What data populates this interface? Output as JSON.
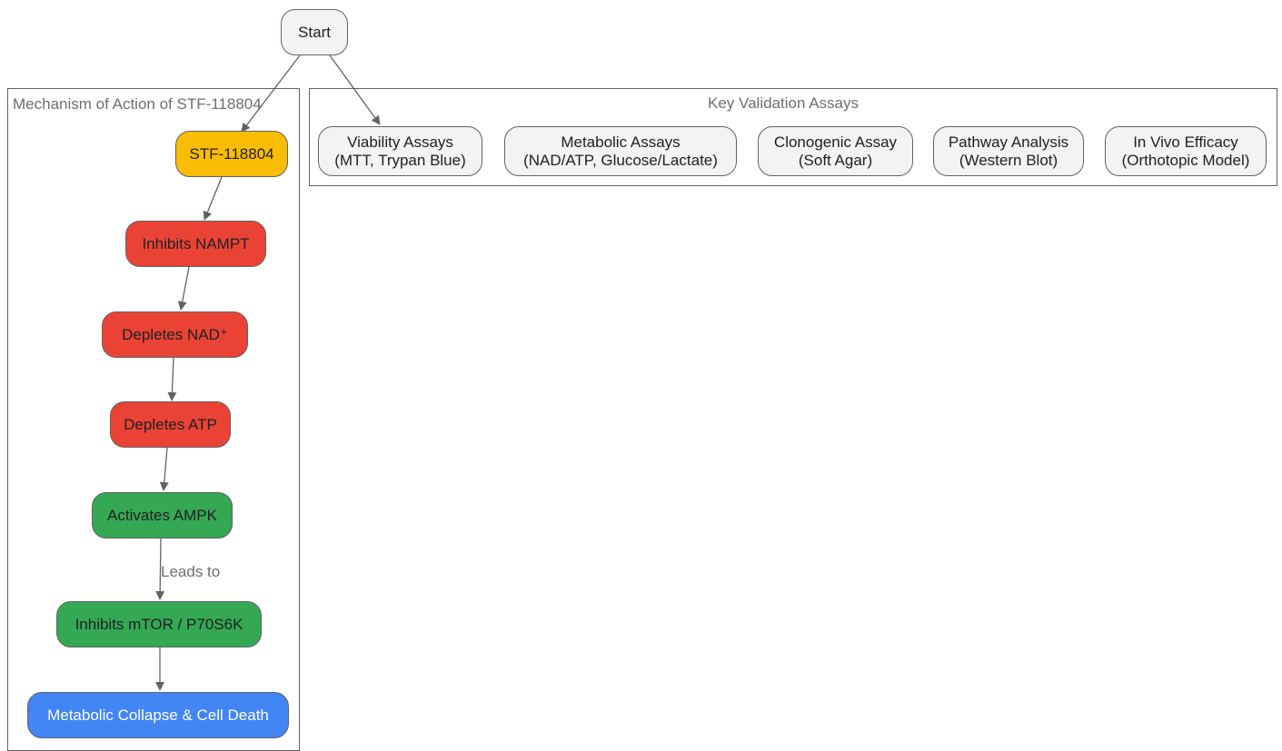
{
  "diagram": {
    "start": "Start",
    "clusters": {
      "mechanism": "Mechanism of Action of STF-118804",
      "assays": "Key Validation Assays"
    },
    "mechanism_nodes": {
      "stf": "STF-118804",
      "nampt": "Inhibits NAMPT",
      "nad": "Depletes NAD⁺",
      "atp": "Depletes ATP",
      "ampk": "Activates AMPK",
      "mtor": "Inhibits mTOR / P70S6K",
      "death": "Metabolic Collapse & Cell Death"
    },
    "edge_labels": {
      "ampk_to_mtor": "Leads to"
    },
    "assays": [
      {
        "line1": "Viability Assays",
        "line2": "(MTT, Trypan Blue)"
      },
      {
        "line1": "Metabolic Assays",
        "line2": "(NAD/ATP, Glucose/Lactate)"
      },
      {
        "line1": "Clonogenic Assay",
        "line2": "(Soft Agar)"
      },
      {
        "line1": "Pathway Analysis",
        "line2": "(Western Blot)"
      },
      {
        "line1": "In Vivo Efficacy",
        "line2": "(Orthotopic Model)"
      }
    ],
    "colors": {
      "drug": "#fbbc04",
      "inhibition": "#ea4335",
      "activation": "#34a853",
      "outcome": "#4285f4",
      "neutral": "#f1f3f4",
      "edge": "#5f6368"
    }
  }
}
